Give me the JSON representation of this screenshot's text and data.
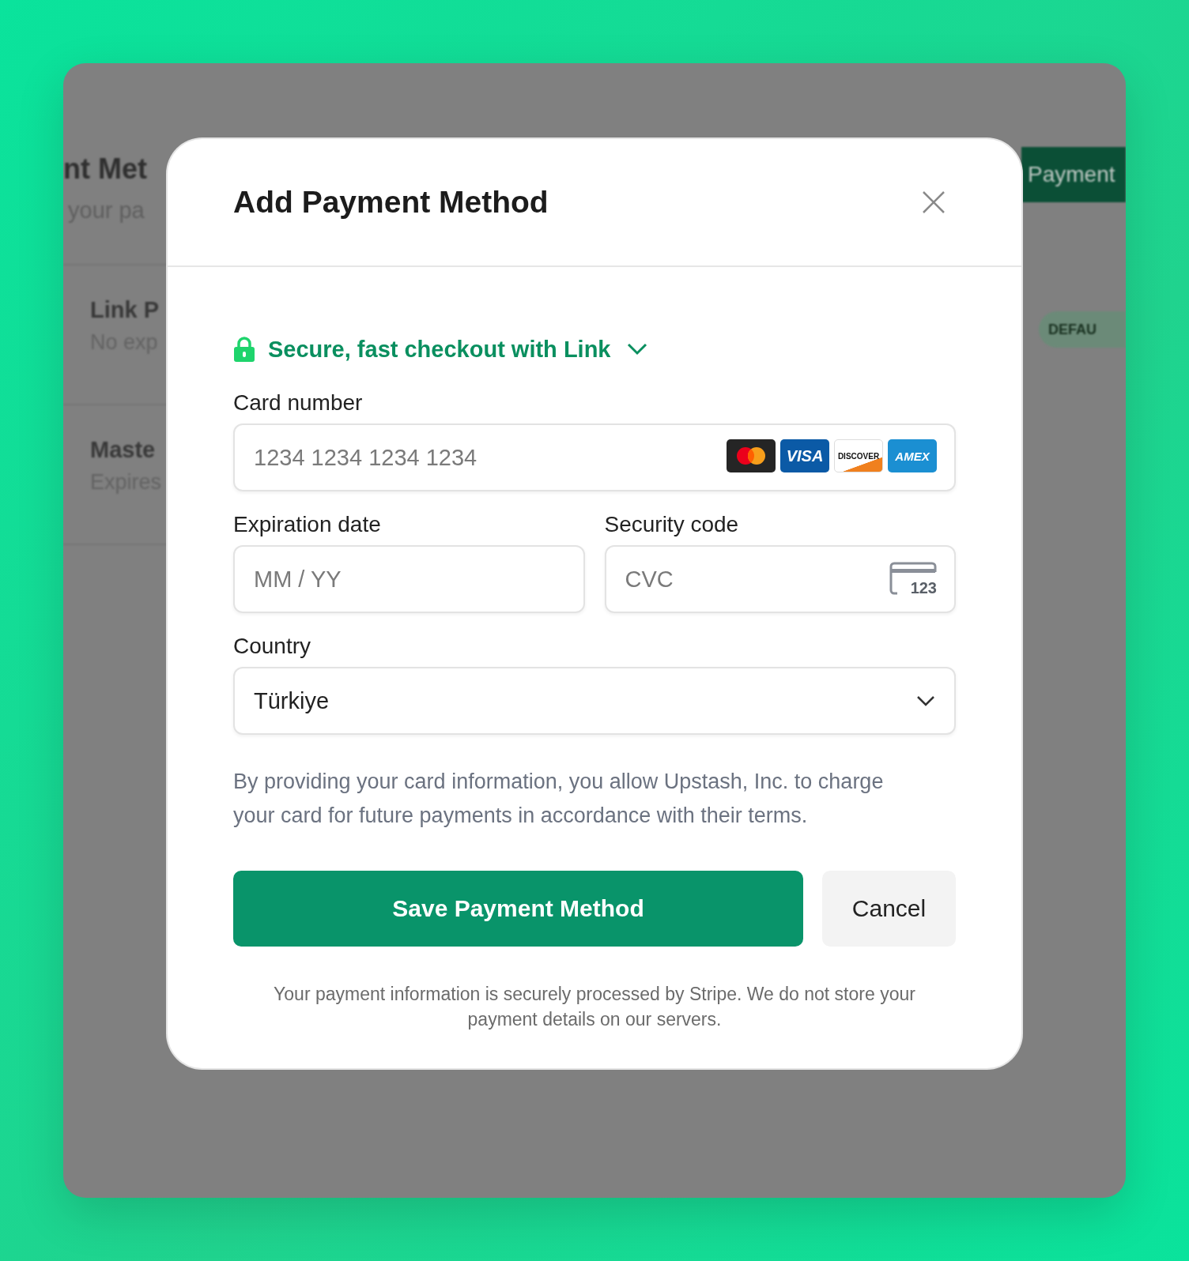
{
  "background_page": {
    "title": "nt Met",
    "subtitle": "your pa",
    "rows": [
      {
        "name": "Link P",
        "detail": "No exp"
      },
      {
        "name": "Maste",
        "detail": "Expires"
      }
    ],
    "button": "Payment",
    "badge": "DEFAU"
  },
  "dialog": {
    "title": "Add Payment Method",
    "link_banner": "Secure, fast checkout with Link",
    "card_number": {
      "label": "Card number",
      "placeholder": "1234 1234 1234 1234",
      "brands": [
        {
          "kind": "mastercard"
        },
        {
          "kind": "visa",
          "label": "VISA"
        },
        {
          "kind": "discover",
          "label": "DISCOVER"
        },
        {
          "kind": "amex",
          "label": "AMEX"
        }
      ]
    },
    "expiration": {
      "label": "Expiration date",
      "placeholder": "MM / YY"
    },
    "security_code": {
      "label": "Security code",
      "placeholder": "CVC",
      "icon_text": "123"
    },
    "country": {
      "label": "Country",
      "value": "Türkiye"
    },
    "consent": "By providing your card information, you allow Upstash, Inc. to charge your card for future payments in accordance with their terms.",
    "buttons": [
      {
        "kind": "primary",
        "label": "Save Payment Method"
      },
      {
        "kind": "secondary",
        "label": "Cancel"
      }
    ],
    "footer": "Your payment information is securely processed by Stripe. We do not store your payment details on our servers."
  }
}
